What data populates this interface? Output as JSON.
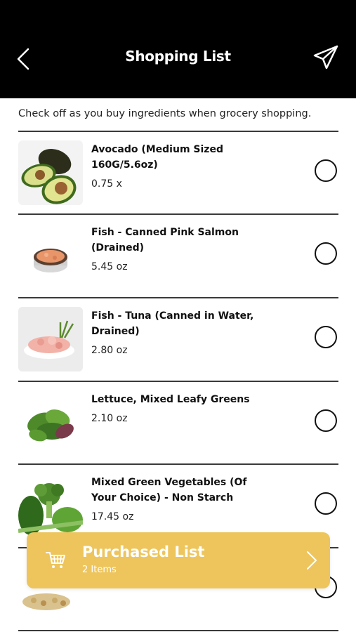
{
  "header": {
    "title": "Shopping List"
  },
  "subtitle": "Check off as you buy ingredients when grocery shopping.",
  "items": [
    {
      "name": "Avocado (Medium Sized 160G/5.6oz)",
      "qty": "0.75 x",
      "icon": "avocado-image"
    },
    {
      "name": "Fish - Canned Pink Salmon (Drained)",
      "qty": "5.45 oz",
      "icon": "canned-salmon-image"
    },
    {
      "name": "Fish - Tuna (Canned in Water, Drained)",
      "qty": "2.80 oz",
      "icon": "tuna-image"
    },
    {
      "name": "Lettuce, Mixed Leafy Greens",
      "qty": "2.10 oz",
      "icon": "lettuce-image"
    },
    {
      "name": "Mixed Green Vegetables (Of Your Choice) - Non Starch",
      "qty": "17.45 oz",
      "icon": "green-vegetables-image"
    }
  ],
  "purchased": {
    "title": "Purchased List",
    "count": "2 Items"
  },
  "colors": {
    "header_bg": "#000000",
    "accent": "#edc55c"
  }
}
